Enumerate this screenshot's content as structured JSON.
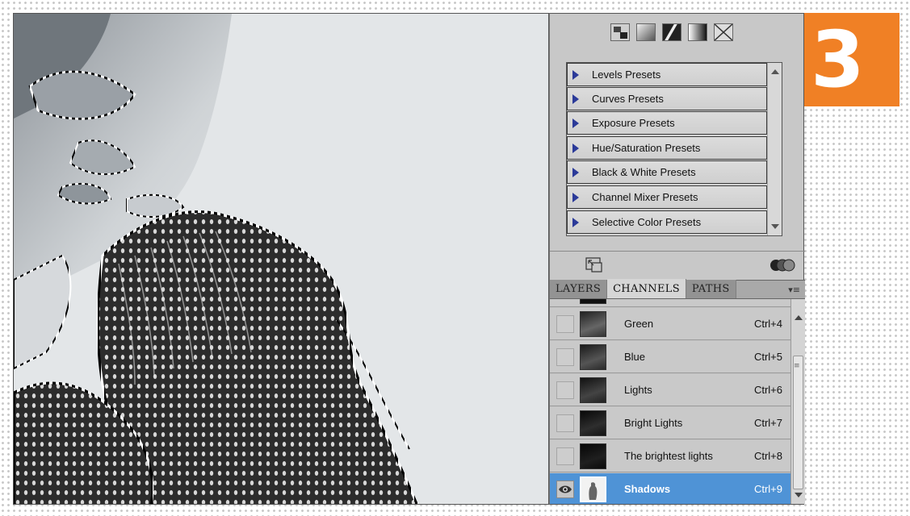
{
  "step": {
    "number": "3",
    "color": "#f08025"
  },
  "adjustments": {
    "icons": [
      "channel-mixer-icon",
      "gradient-map-icon",
      "threshold-icon",
      "black-white-gradient-icon",
      "invert-icon"
    ],
    "presets": [
      {
        "label": "Levels Presets"
      },
      {
        "label": "Curves Presets"
      },
      {
        "label": "Exposure Presets"
      },
      {
        "label": "Hue/Saturation Presets"
      },
      {
        "label": "Black & White Presets"
      },
      {
        "label": "Channel Mixer Presets"
      },
      {
        "label": "Selective Color Presets"
      }
    ],
    "footer_icons": [
      "expand-view-icon",
      "overlapping-circles-icon"
    ]
  },
  "panel_tabs": [
    {
      "label": "LAYERS",
      "state": "inactive"
    },
    {
      "label": "CHANNELS",
      "state": "active"
    },
    {
      "label": "PATHS",
      "state": "inactive"
    }
  ],
  "panel_menu_icon": "panel-menu-icon",
  "channels": [
    {
      "name": "",
      "shortcut": "",
      "visible": false,
      "selected": false
    },
    {
      "name": "Green",
      "shortcut": "Ctrl+4",
      "visible": false,
      "selected": false
    },
    {
      "name": "Blue",
      "shortcut": "Ctrl+5",
      "visible": false,
      "selected": false
    },
    {
      "name": "Lights",
      "shortcut": "Ctrl+6",
      "visible": false,
      "selected": false
    },
    {
      "name": "Bright Lights",
      "shortcut": "Ctrl+7",
      "visible": false,
      "selected": false
    },
    {
      "name": "The brightest lights",
      "shortcut": "Ctrl+8",
      "visible": false,
      "selected": false
    },
    {
      "name": "Shadows",
      "shortcut": "Ctrl+9",
      "visible": true,
      "selected": true
    }
  ],
  "colors": {
    "selection_highlight": "#4f93d6",
    "preset_arrow": "#2b3a99",
    "panel_bg": "#c8c8c8"
  }
}
